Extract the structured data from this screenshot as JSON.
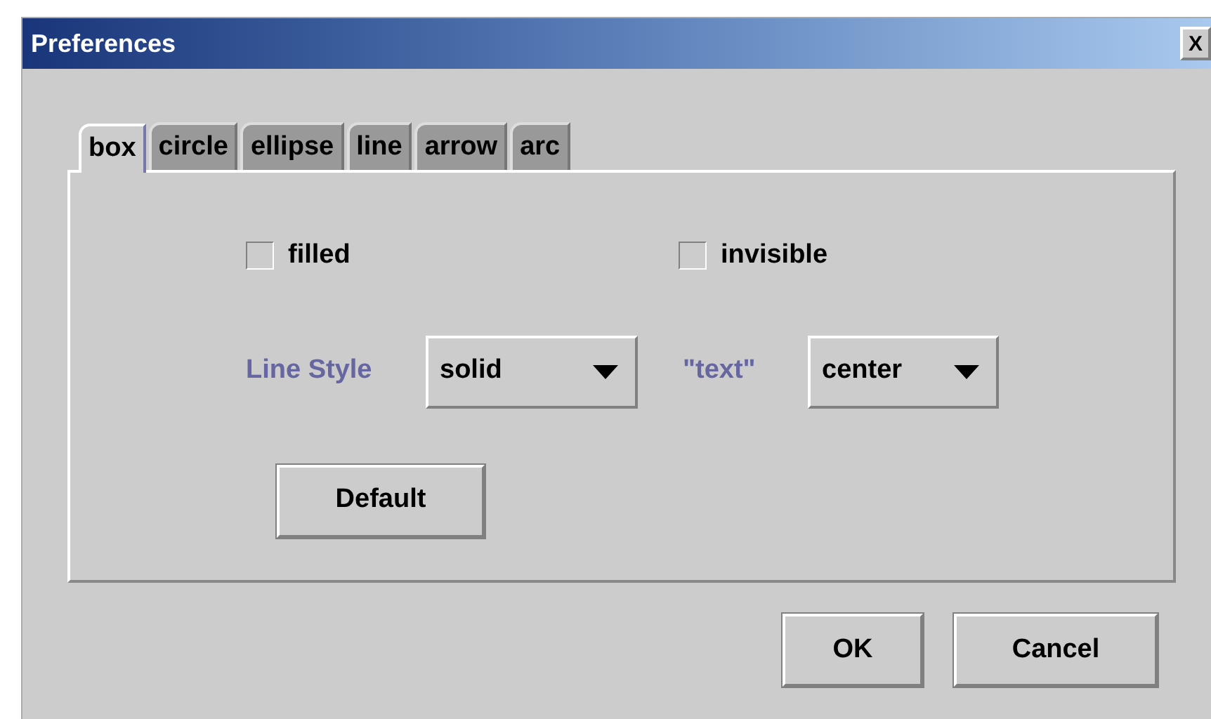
{
  "window": {
    "title": "Preferences",
    "close": "X"
  },
  "tabs": [
    {
      "label": "box",
      "selected": true
    },
    {
      "label": "circle",
      "selected": false
    },
    {
      "label": "ellipse",
      "selected": false
    },
    {
      "label": "line",
      "selected": false
    },
    {
      "label": "arrow",
      "selected": false
    },
    {
      "label": "arc",
      "selected": false
    }
  ],
  "checkboxes": [
    {
      "label": "filled",
      "checked": false
    },
    {
      "label": "invisible",
      "checked": false
    }
  ],
  "dropdowns": [
    {
      "label": "Line Style",
      "value": "solid"
    },
    {
      "label": "\"text\"",
      "value": "center"
    }
  ],
  "default_button": "Default",
  "buttons": [
    "OK",
    "Cancel"
  ]
}
